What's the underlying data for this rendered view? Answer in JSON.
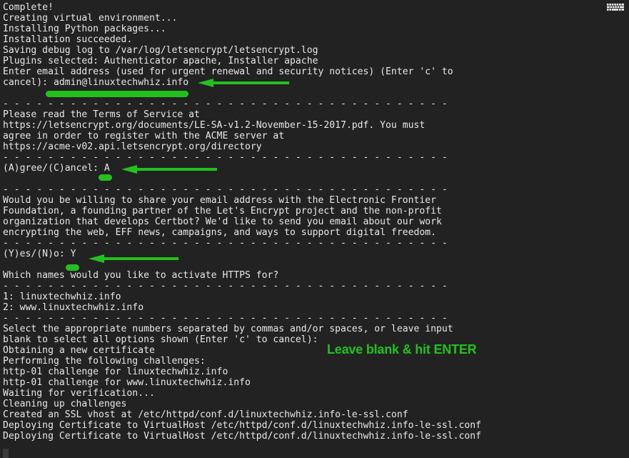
{
  "window": {
    "title": "Certbot terminal session",
    "background_color": "#222222",
    "text_color": "#e8e8e8",
    "accent_color": "#22c11e"
  },
  "icons": {
    "keyboard": "keyboard-icon"
  },
  "terminal": {
    "lines": [
      "Complete!",
      "Creating virtual environment...",
      "Installing Python packages...",
      "Installation succeeded.",
      "Saving debug log to /var/log/letsencrypt/letsencrypt.log",
      "Plugins selected: Authenticator apache, Installer apache",
      "Enter email address (used for urgent renewal and security notices) (Enter 'c' to",
      "cancel): admin@linuxtechwhiz.info",
      "",
      "- - - - - - - - - - - - - - - - - - - - - - - - - - - - - - - - - - - - - - - -",
      "Please read the Terms of Service at",
      "https://letsencrypt.org/documents/LE-SA-v1.2-November-15-2017.pdf. You must",
      "agree in order to register with the ACME server at",
      "https://acme-v02.api.letsencrypt.org/directory",
      "- - - - - - - - - - - - - - - - - - - - - - - - - - - - - - - - - - - - - - - -",
      "(A)gree/(C)ancel: A",
      "",
      "- - - - - - - - - - - - - - - - - - - - - - - - - - - - - - - - - - - - - - - -",
      "Would you be willing to share your email address with the Electronic Frontier",
      "Foundation, a founding partner of the Let's Encrypt project and the non-profit",
      "organization that develops Certbot? We'd like to send you email about our work",
      "encrypting the web, EFF news, campaigns, and ways to support digital freedom.",
      "- - - - - - - - - - - - - - - - - - - - - - - - - - - - - - - - - - - - - - - -",
      "(Y)es/(N)o: Y",
      "",
      "Which names would you like to activate HTTPS for?",
      "- - - - - - - - - - - - - - - - - - - - - - - - - - - - - - - - - - - - - - - -",
      "1: linuxtechwhiz.info",
      "2: www.linuxtechwhiz.info",
      "- - - - - - - - - - - - - - - - - - - - - - - - - - - - - - - - - - - - - - - -",
      "Select the appropriate numbers separated by commas and/or spaces, or leave input",
      "blank to select all options shown (Enter 'c' to cancel):",
      "Obtaining a new certificate",
      "Performing the following challenges:",
      "http-01 challenge for linuxtechwhiz.info",
      "http-01 challenge for www.linuxtechwhiz.info",
      "Waiting for verification...",
      "Cleaning up challenges",
      "Created an SSL vhost at /etc/httpd/conf.d/linuxtechwhiz.info-le-ssl.conf",
      "Deploying Certificate to VirtualHost /etc/httpd/conf.d/linuxtechwhiz.info-le-ssl.conf",
      "Deploying Certificate to VirtualHost /etc/httpd/conf.d/linuxtechwhiz.info-le-ssl.conf"
    ]
  },
  "annotations": {
    "note_text": "Leave blank & hit ENTER",
    "highlights": [
      {
        "name": "email-value",
        "value": "admin@linuxtechwhiz.info"
      },
      {
        "name": "agree-answer",
        "value": "A"
      },
      {
        "name": "eff-answer",
        "value": "Y"
      }
    ]
  }
}
